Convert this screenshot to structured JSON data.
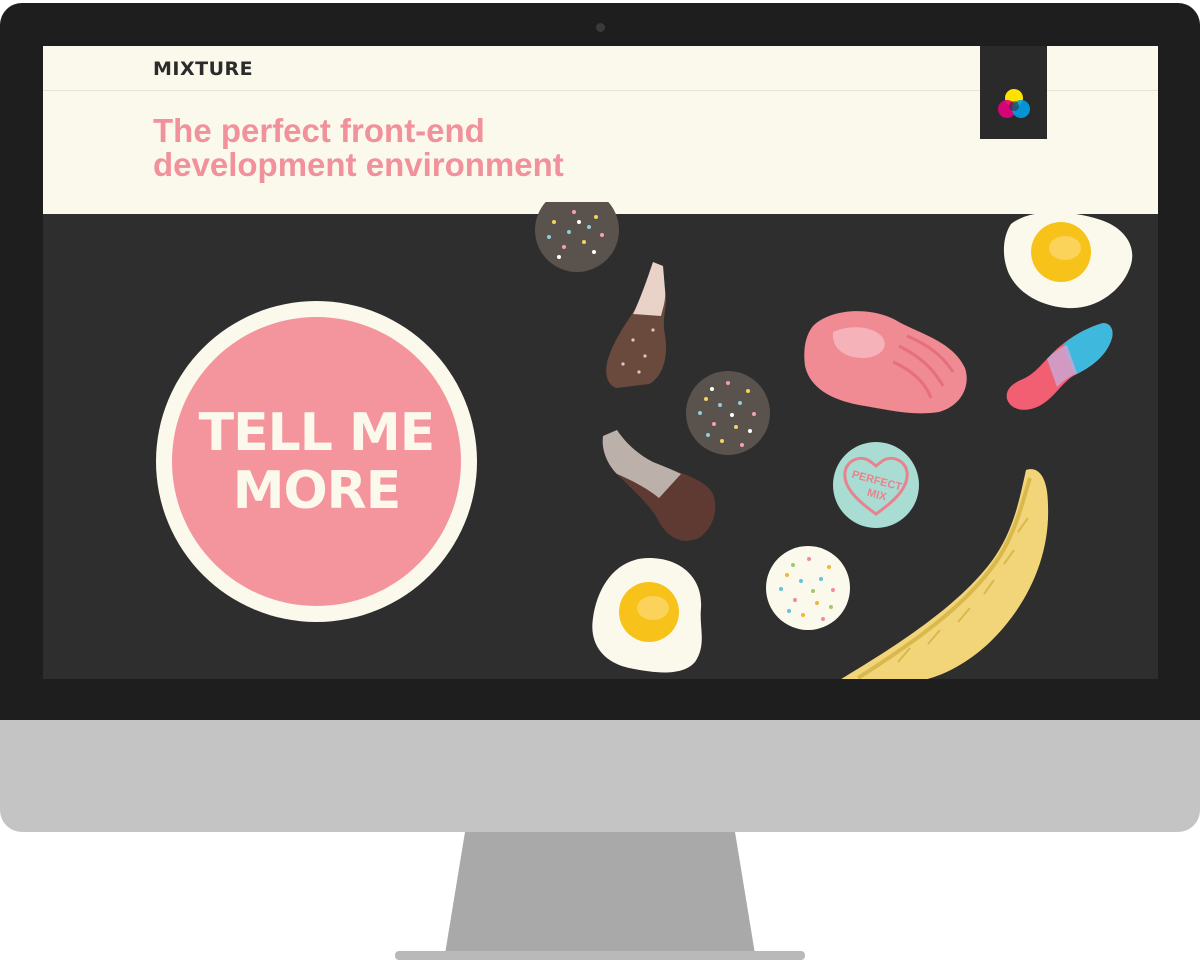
{
  "site": {
    "brand": "MIXTURE",
    "headline_line1": "The perfect front-end",
    "headline_line2": "development environment"
  },
  "cta": {
    "line1": "TELL ME",
    "line2": "MORE"
  },
  "candy": {
    "heart_line1": "PERFECT",
    "heart_line2": "MIX"
  },
  "colors": {
    "cream": "#fbf9ec",
    "pink": "#f4959d",
    "dark": "#2e2e2e",
    "bezel": "#1e1e1e",
    "chin": "#c4c4c4",
    "yolk": "#f7c21a",
    "banana": "#f2d578",
    "mint": "#a9ddd3"
  },
  "icons": [
    "cmy-circles-logo",
    "sprinkle-candy-icon",
    "cola-bottle-icon",
    "ham-icon",
    "fried-egg-icon",
    "banana-icon",
    "heart-candy-icon",
    "fizzy-bottle-icon"
  ]
}
